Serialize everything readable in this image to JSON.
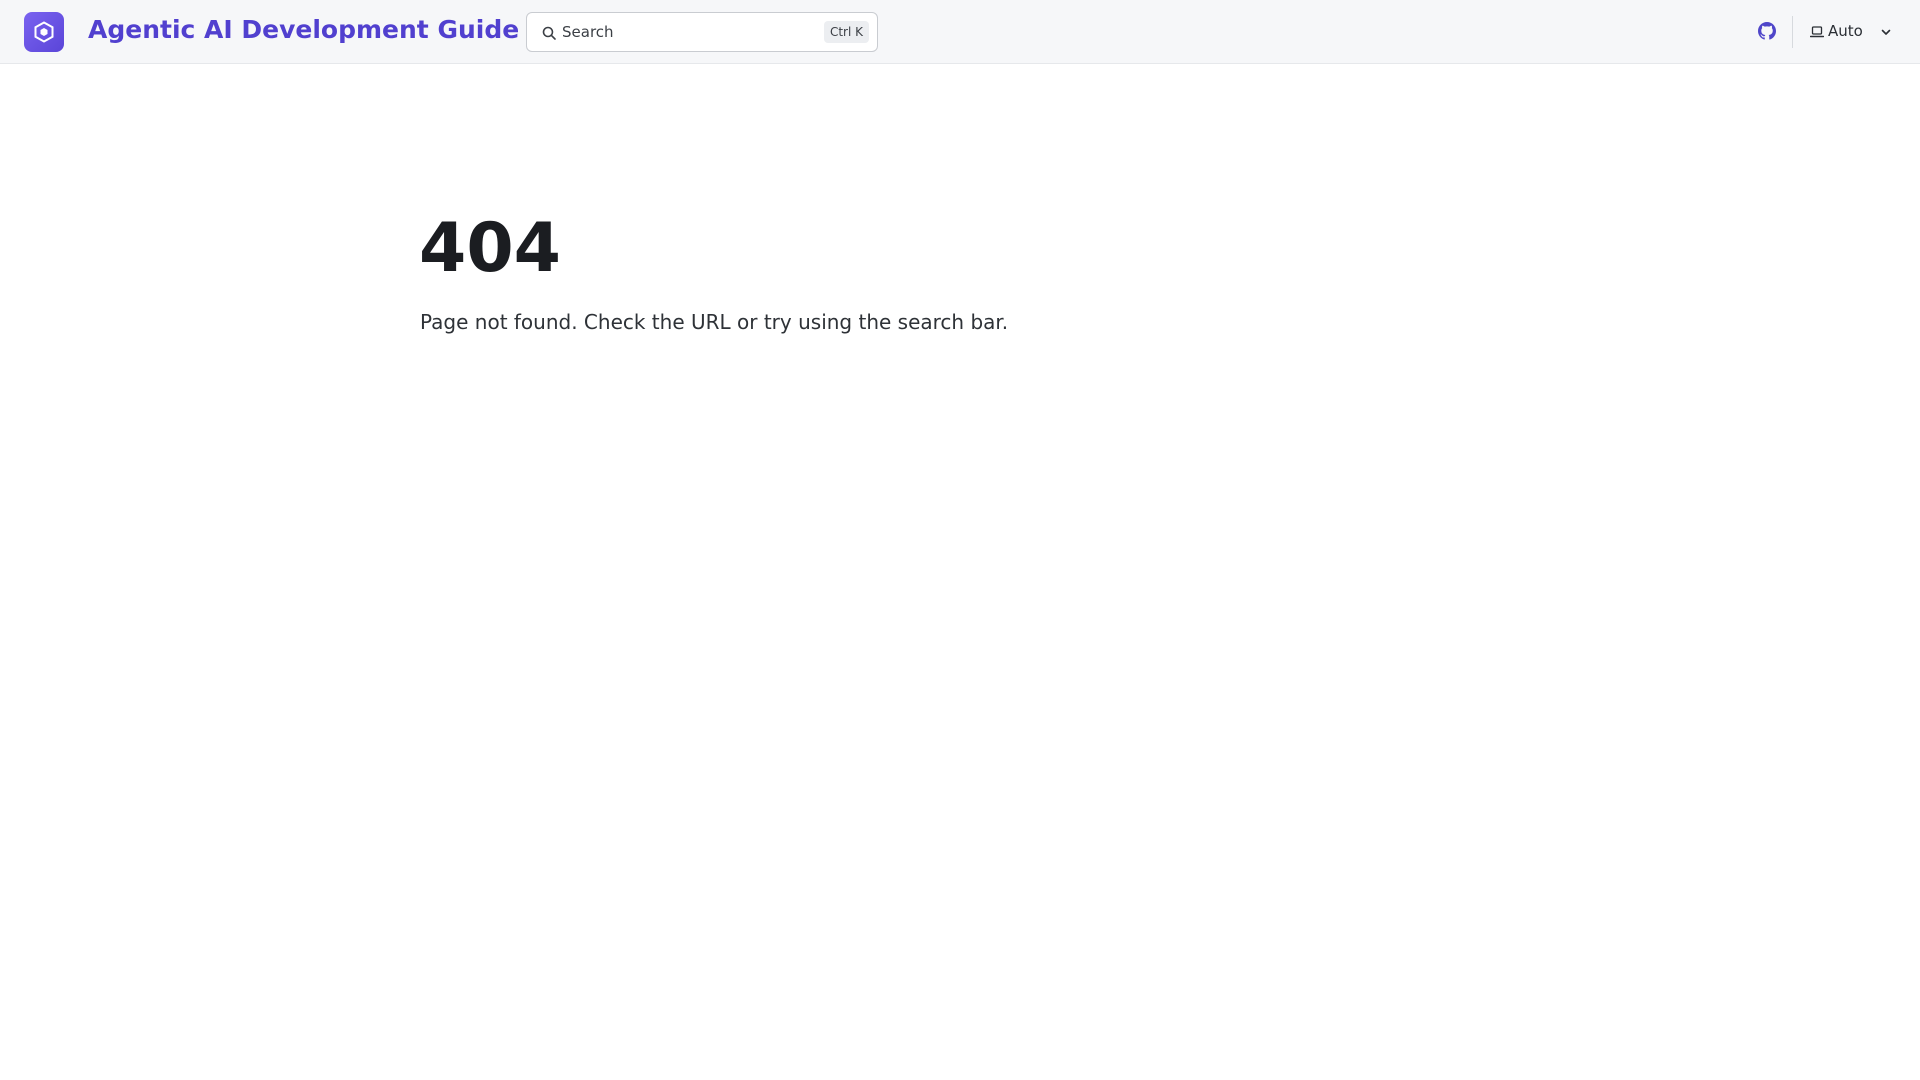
{
  "header": {
    "site_title": "Agentic AI Development Guide",
    "logo_icon": "hexagon-logo-icon",
    "search": {
      "placeholder": "Search",
      "shortcut": "Ctrl K"
    },
    "github_icon": "github-icon",
    "theme": {
      "selected": "Auto",
      "icon": "laptop-icon"
    }
  },
  "main": {
    "error_code": "404",
    "error_message": "Page not found. Check the URL or try using the search bar."
  },
  "colors": {
    "brand": "#5140cf",
    "logo_bg": "#6a55e6",
    "header_bg": "#f6f7f9"
  }
}
